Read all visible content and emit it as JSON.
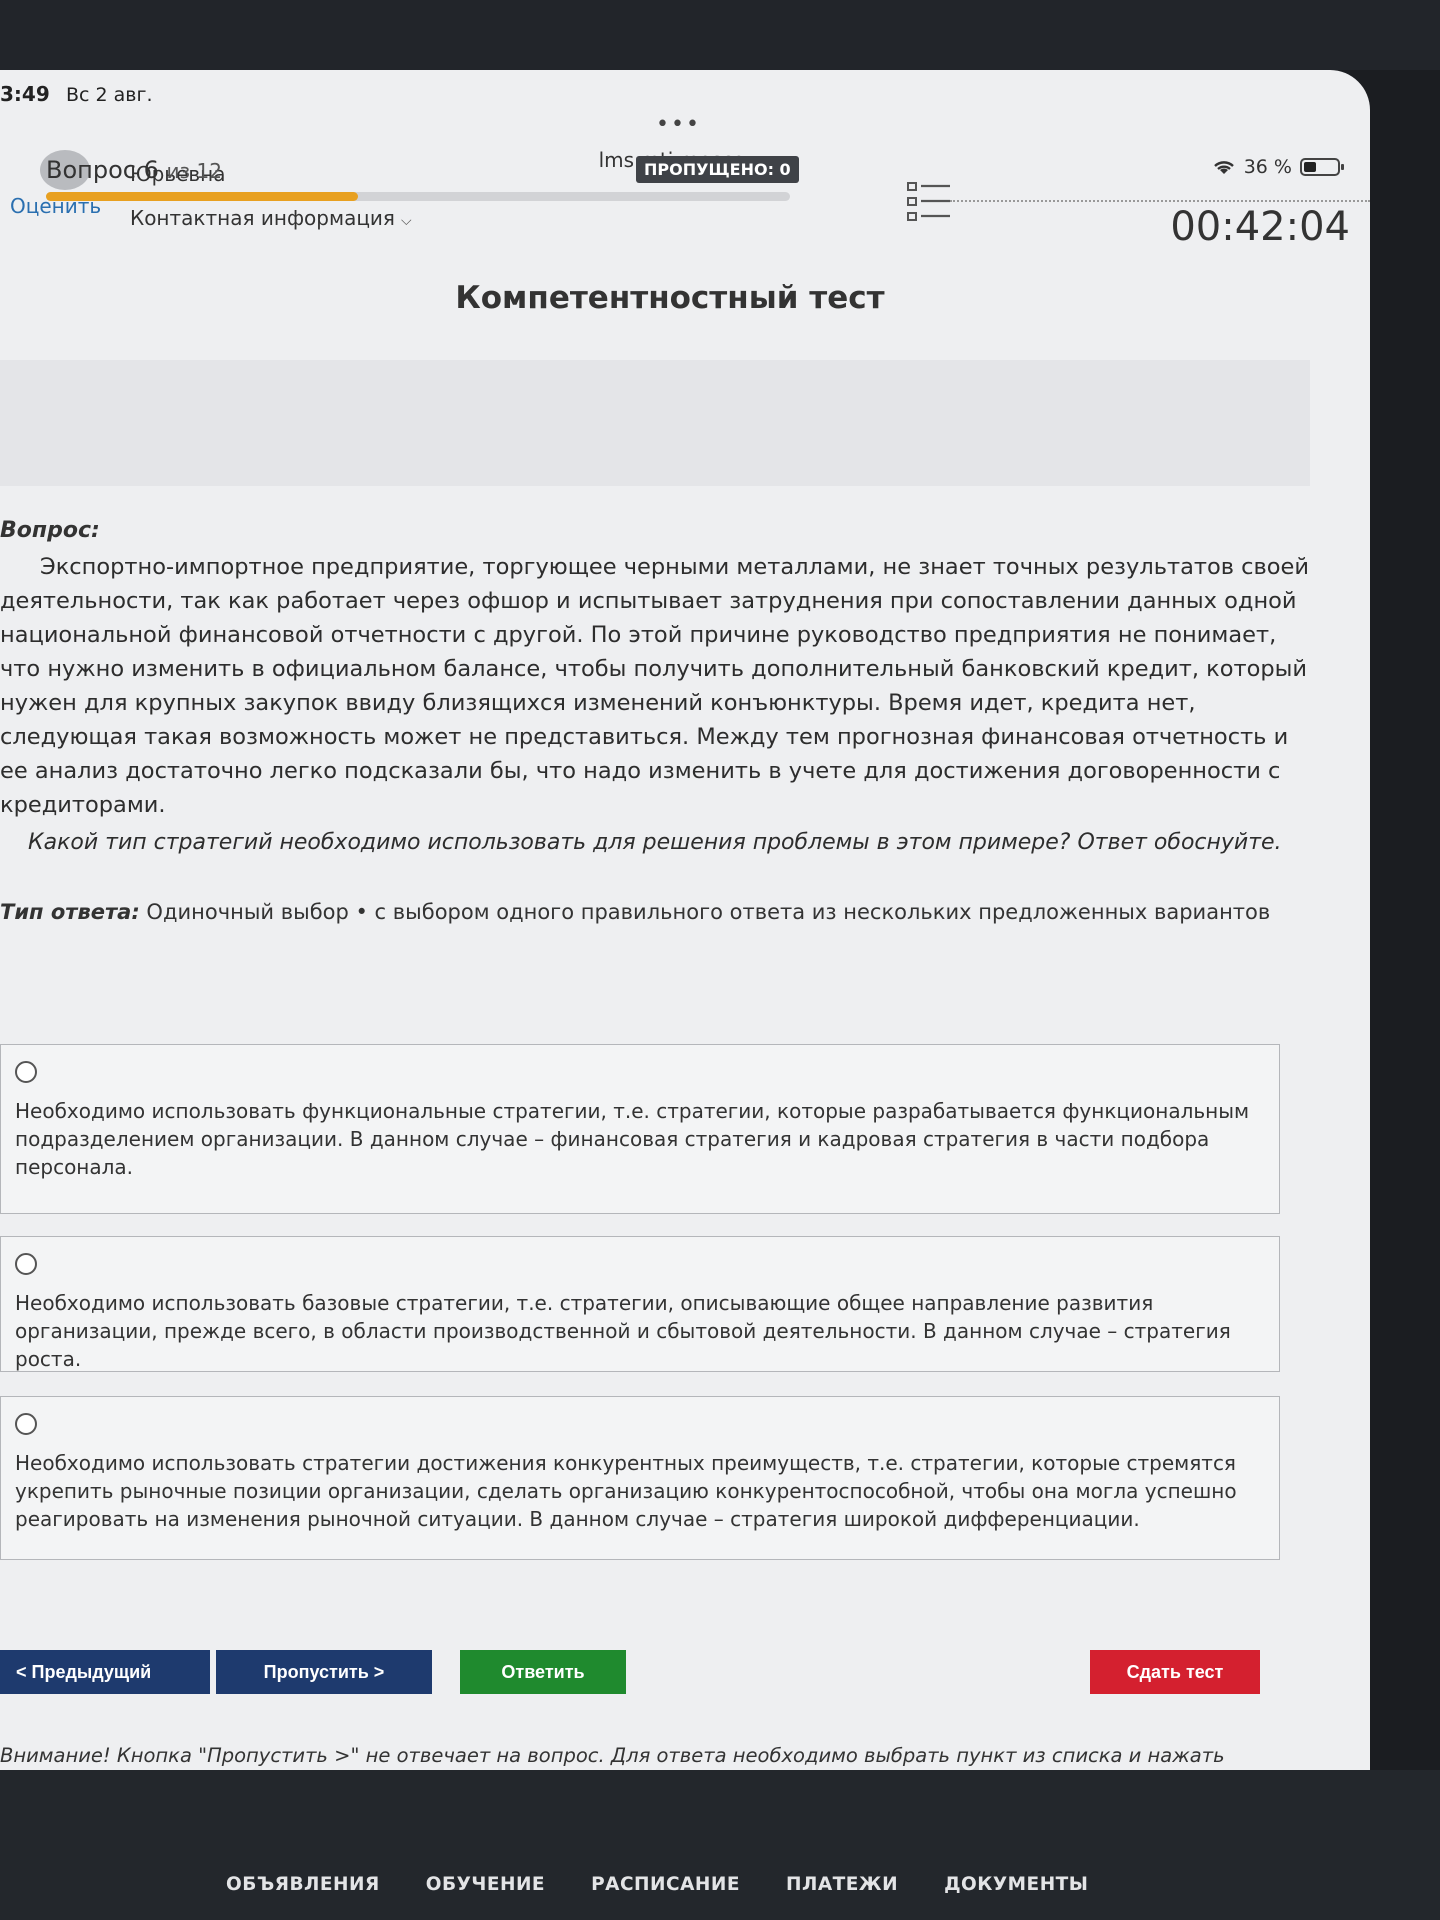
{
  "status_bar": {
    "time": "3:49",
    "date": "Вс 2 авг.",
    "url": "lms.mti.moscow",
    "battery": "36 %",
    "dots": "•••"
  },
  "user": {
    "name": "Юрьевна",
    "rate_link": "Оценить",
    "contact_link": "Контактная информация"
  },
  "test": {
    "title": "Компетентностный тест",
    "question_word": "Вопрос 6",
    "question_of": "из 12",
    "progress_fraction": 0.42,
    "skipped_label": "ПРОПУЩЕНО: 0",
    "timer": "00:42:04"
  },
  "question": {
    "label": "Вопрос:",
    "text": "Экспортно-импортное предприятие, торгующее черными металлами, не знает точных результатов своей деятельности, так как работает через офшор и испытывает затруднения при сопоставлении данных одной национальной финансовой отчетности с другой. По этой причине руководство предприятия не понимает, что нужно изменить в официальном балансе, чтобы получить дополнительный банковский кредит, который нужен для крупных закупок ввиду близящихся изменений конъюнктуры. Время идет, кредита нет, следующая такая возможность может не представиться. Между тем прогнозная финансовая отчетность и ее анализ достаточно легко подсказали бы, что надо изменить в учете для достижения договоренности с кредиторами.",
    "ask": "Какой тип стратегий необходимо использовать для решения проблемы в этом примере? Ответ обоснуйте.",
    "answer_type_label": "Тип ответа:",
    "answer_type_value": "Одиночный выбор • с выбором одного правильного ответа из нескольких предложенных вариантов"
  },
  "options": [
    "Необходимо использовать функциональные стратегии, т.е. стратегии, которые разрабатывается функциональным подразделением организации. В данном случае – финансовая стратегия и кадровая стратегия в части подбора персонала.",
    "Необходимо использовать базовые стратегии, т.е. стратегии, описывающие общее направление развития организации, прежде всего, в области производственной и сбытовой деятельности. В данном случае – стратегия роста.",
    "Необходимо использовать стратегии достижения конкурентных преимуществ, т.е. стратегии, которые стремятся укрепить рыночные позиции организации, сделать организацию конкурентоспособной, чтобы она могла успешно реагировать на изменения рыночной ситуации. В данном случае – стратегия широкой дифференциации."
  ],
  "buttons": {
    "prev": "< Предыдущий",
    "skip": "Пропустить >",
    "answer": "Ответить",
    "submit": "Сдать тест"
  },
  "warning": "Внимание! Кнопка \"Пропустить >\" не отвечает на вопрос. Для ответа необходимо выбрать пункт из списка и нажать кнопку \"Ответить\".",
  "nav": [
    "ОБЪЯВЛЕНИЯ",
    "ОБУЧЕНИЕ",
    "РАСПИСАНИЕ",
    "ПЛАТЕЖИ",
    "ДОКУМЕНТЫ"
  ],
  "colors": {
    "progress": "#e8a020",
    "nav_button": "#1e3a6e",
    "answer_button": "#1f8a2e",
    "submit_button": "#d4202f"
  }
}
